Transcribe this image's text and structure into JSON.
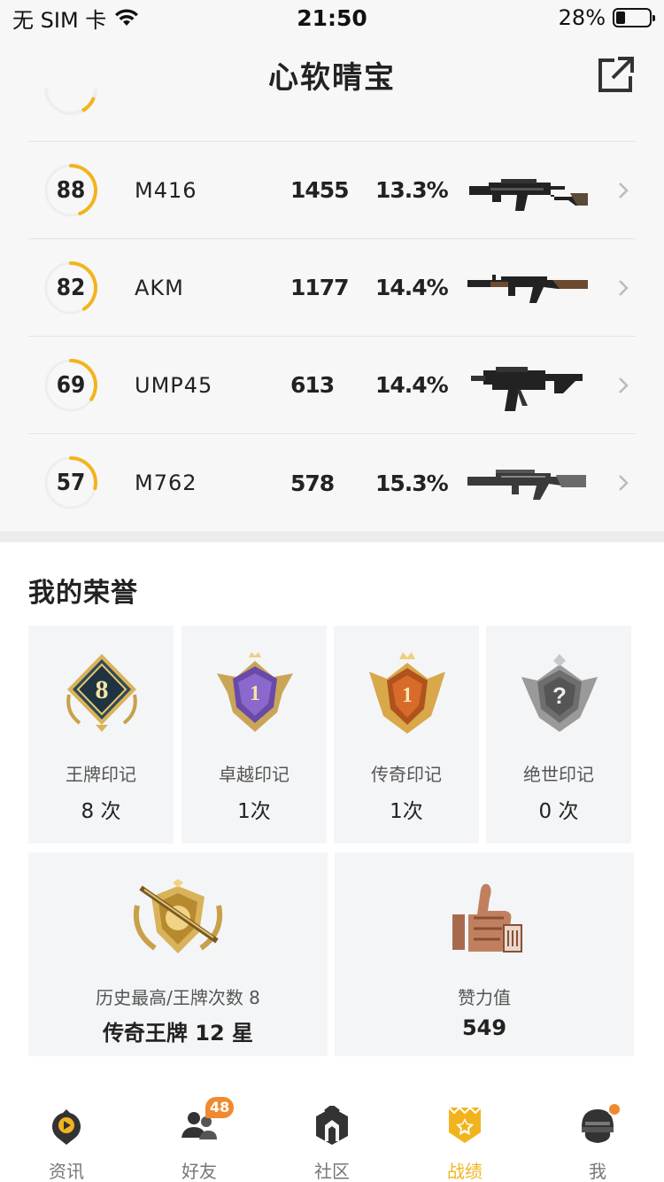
{
  "status": {
    "carrier": "无 SIM 卡",
    "time": "21:50",
    "battery": "28%",
    "battery_level": 0.28
  },
  "nav": {
    "title": "心软晴宝"
  },
  "weapons": [
    {
      "score": "88",
      "score_value": 88,
      "name": "M416",
      "count": "1455",
      "rate": "13.3%",
      "icon": "m416-rifle"
    },
    {
      "score": "82",
      "score_value": 82,
      "name": "AKM",
      "count": "1177",
      "rate": "14.4%",
      "icon": "akm-rifle"
    },
    {
      "score": "69",
      "score_value": 69,
      "name": "UMP45",
      "count": "613",
      "rate": "14.4%",
      "icon": "ump45-smg"
    },
    {
      "score": "57",
      "score_value": 57,
      "name": "M762",
      "count": "578",
      "rate": "15.3%",
      "icon": "m762-rifle"
    }
  ],
  "honor": {
    "title": "我的荣誉",
    "badges": [
      {
        "label": "王牌印记",
        "count": "8 次",
        "icon": "ace-badge-icon",
        "number": "8"
      },
      {
        "label": "卓越印记",
        "count": "1次",
        "icon": "excellence-badge-icon",
        "number": "1"
      },
      {
        "label": "传奇印记",
        "count": "1次",
        "icon": "legend-badge-icon",
        "number": "1"
      },
      {
        "label": "绝世印记",
        "count": "0 次",
        "icon": "peerless-badge-icon",
        "number": "?"
      }
    ],
    "highest": {
      "label": "历史最高/王牌次数 8",
      "value": "传奇王牌 12 星",
      "icon": "conqueror-emblem-icon"
    },
    "likes": {
      "label": "赞力值",
      "value": "549",
      "icon": "thumbs-up-icon"
    }
  },
  "tabs": [
    {
      "label": "资讯",
      "icon": "news-icon",
      "active": false
    },
    {
      "label": "好友",
      "icon": "friends-icon",
      "active": false,
      "badge": "48"
    },
    {
      "label": "社区",
      "icon": "community-icon",
      "active": false
    },
    {
      "label": "战绩",
      "icon": "record-icon",
      "active": true
    },
    {
      "label": "我",
      "icon": "profile-icon",
      "active": false
    }
  ],
  "colors": {
    "accent": "#f2b41e",
    "badge": "#f08a30",
    "ring_track": "#eeeeee"
  }
}
